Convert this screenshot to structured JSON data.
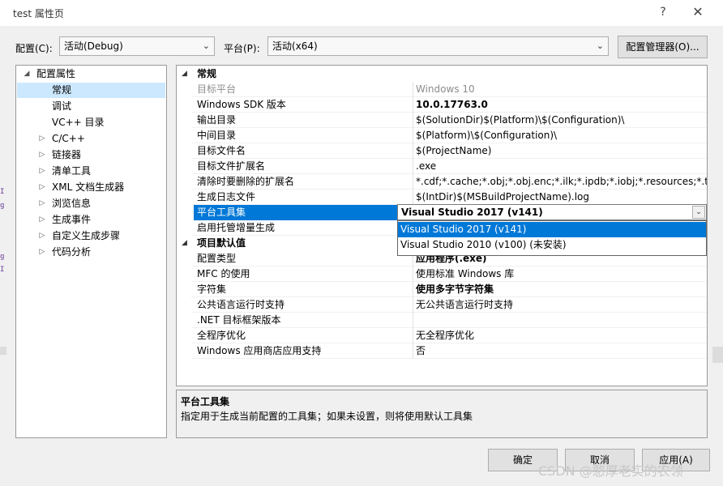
{
  "window": {
    "title": "test 属性页",
    "help_glyph": "?",
    "close_glyph": "✕"
  },
  "config_row": {
    "config_label": "配置(C):",
    "config_value": "活动(Debug)",
    "platform_label": "平台(P):",
    "platform_value": "活动(x64)",
    "manager_button": "配置管理器(O)..."
  },
  "tree": {
    "items": [
      {
        "label": "配置属性",
        "arrow": "◢",
        "level": 0
      },
      {
        "label": "常规",
        "arrow": "",
        "level": 1,
        "selected": true
      },
      {
        "label": "调试",
        "arrow": "",
        "level": 1
      },
      {
        "label": "VC++ 目录",
        "arrow": "",
        "level": 1
      },
      {
        "label": "C/C++",
        "arrow": "▷",
        "level": 1
      },
      {
        "label": "链接器",
        "arrow": "▷",
        "level": 1
      },
      {
        "label": "清单工具",
        "arrow": "▷",
        "level": 1
      },
      {
        "label": "XML 文档生成器",
        "arrow": "▷",
        "level": 1
      },
      {
        "label": "浏览信息",
        "arrow": "▷",
        "level": 1
      },
      {
        "label": "生成事件",
        "arrow": "▷",
        "level": 1
      },
      {
        "label": "自定义生成步骤",
        "arrow": "▷",
        "level": 1
      },
      {
        "label": "代码分析",
        "arrow": "▷",
        "level": 1
      }
    ]
  },
  "grid": {
    "section1": {
      "title": "常规",
      "arrow": "◢"
    },
    "rows1": [
      {
        "name": "目标平台",
        "value": "Windows 10",
        "grey": true
      },
      {
        "name": "Windows SDK 版本",
        "value": "10.0.17763.0",
        "bold": true
      },
      {
        "name": "输出目录",
        "value": "$(SolutionDir)$(Platform)\\$(Configuration)\\"
      },
      {
        "name": "中间目录",
        "value": "$(Platform)\\$(Configuration)\\"
      },
      {
        "name": "目标文件名",
        "value": "$(ProjectName)"
      },
      {
        "name": "目标文件扩展名",
        "value": ".exe"
      },
      {
        "name": "清除时要删除的扩展名",
        "value": "*.cdf;*.cache;*.obj;*.obj.enc;*.ilk;*.ipdb;*.iobj;*.resources;*.tlb;*.tli;*.t"
      },
      {
        "name": "生成日志文件",
        "value": "$(IntDir)$(MSBuildProjectName).log"
      },
      {
        "name": "平台工具集",
        "value": "",
        "selected": true
      },
      {
        "name": "启用托管增量生成",
        "value": ""
      }
    ],
    "section2": {
      "title": "项目默认值",
      "arrow": "◢"
    },
    "rows2": [
      {
        "name": "配置类型",
        "value": "应用程序(.exe)",
        "bold": true
      },
      {
        "name": "MFC 的使用",
        "value": "使用标准 Windows 库"
      },
      {
        "name": "字符集",
        "value": "使用多字节字符集",
        "bold": true
      },
      {
        "name": "公共语言运行时支持",
        "value": "无公共语言运行时支持"
      },
      {
        "name": ".NET 目标框架版本",
        "value": ""
      },
      {
        "name": "全程序优化",
        "value": "无全程序优化"
      },
      {
        "name": "Windows 应用商店应用支持",
        "value": "否"
      }
    ]
  },
  "dropdown": {
    "current": "Visual Studio 2017 (v141)",
    "arrow": "⌄",
    "options": [
      {
        "label": "Visual Studio 2017 (v141)",
        "selected": true
      },
      {
        "label": "Visual Studio 2010 (v100) (未安装)",
        "selected": false
      }
    ]
  },
  "description": {
    "title": "平台工具集",
    "text": "指定用于生成当前配置的工具集；如果未设置，则将使用默认工具集"
  },
  "buttons": {
    "ok": "确定",
    "cancel": "取消",
    "apply": "应用(A)"
  },
  "watermark": "CSDN @憨厚老实的农领"
}
